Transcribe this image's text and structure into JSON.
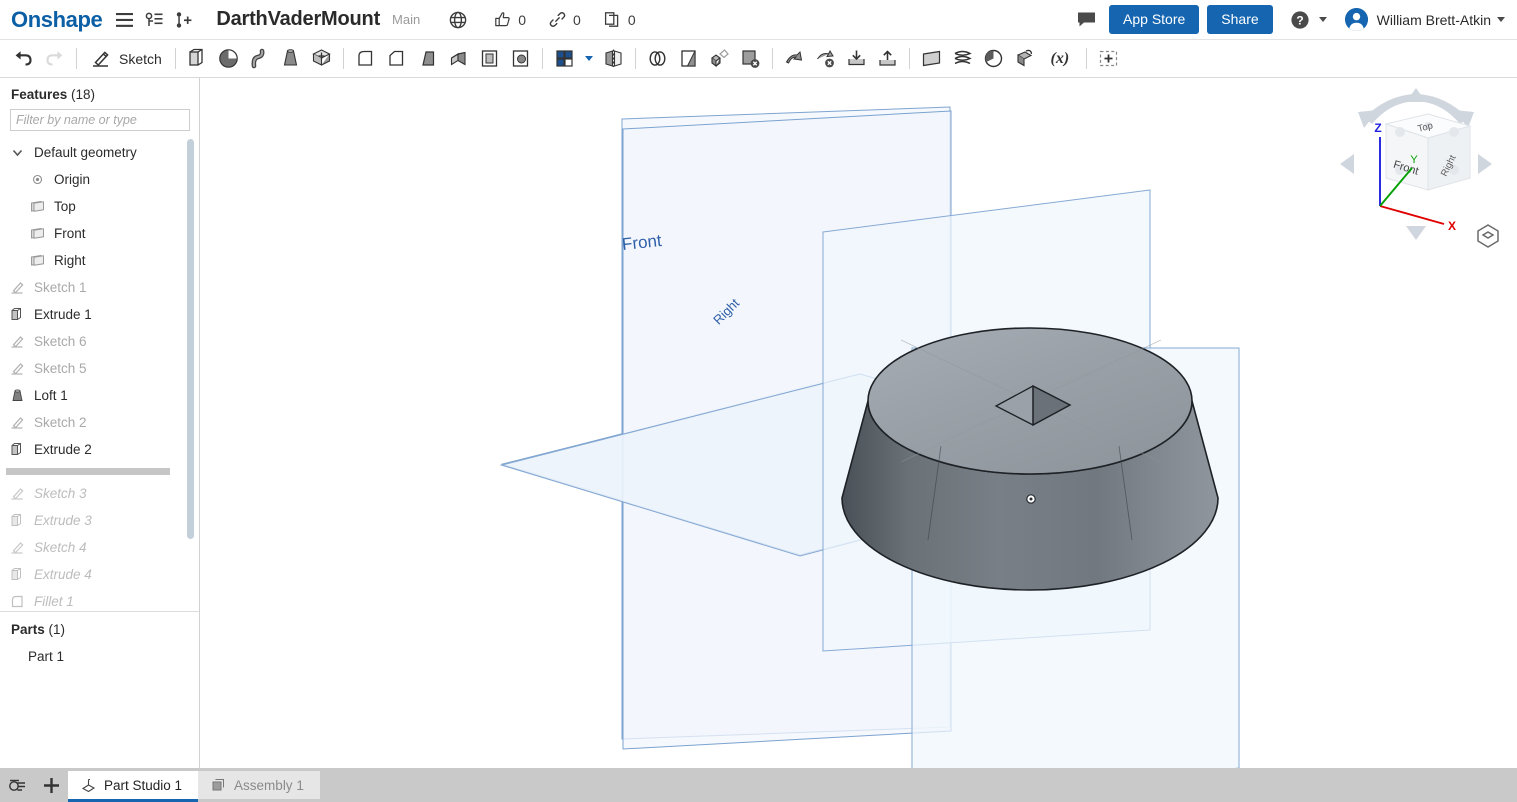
{
  "header": {
    "brand": "Onshape",
    "hamburger_icon": "hamburger-menu-icon",
    "versions_icon": "version-history-icon",
    "branch_icon": "branch-add-icon",
    "document_title": "DarthVaderMount",
    "workspace": "Main",
    "globe_icon": "globe-icon",
    "counters": [
      {
        "icon": "thumbs-up-icon",
        "value": "0"
      },
      {
        "icon": "link-icon",
        "value": "0"
      },
      {
        "icon": "copy-icon",
        "value": "0"
      }
    ],
    "comment_icon": "comment-bubble-icon",
    "app_store_label": "App Store",
    "share_label": "Share",
    "help_icon": "help-circle-icon",
    "user_name": "William Brett-Atkin",
    "accent_color": "#1565b0"
  },
  "toolbar": {
    "undo_icon": "undo-arrow-icon",
    "redo_icon": "redo-arrow-icon",
    "sketch_label": "Sketch",
    "sketch_icon": "sketch-pencil-icon",
    "tools": [
      {
        "icon": "extrude-icon"
      },
      {
        "icon": "revolve-icon"
      },
      {
        "icon": "sweep-icon"
      },
      {
        "icon": "loft-icon"
      },
      {
        "icon": "thicken-icon"
      },
      {
        "icon": "fillet-icon"
      },
      {
        "icon": "chamfer-icon"
      },
      {
        "icon": "draft-icon"
      },
      {
        "icon": "rib-icon"
      },
      {
        "icon": "shell-icon"
      },
      {
        "icon": "hole-icon"
      },
      {
        "icon": "pattern-icon"
      },
      {
        "icon": "mirror-icon"
      },
      {
        "icon": "boolean-icon"
      },
      {
        "icon": "split-icon"
      },
      {
        "icon": "transform-icon"
      },
      {
        "icon": "delete-face-icon"
      },
      {
        "icon": "move-face-icon"
      },
      {
        "icon": "replace-face-icon"
      },
      {
        "icon": "import-derived-icon"
      },
      {
        "icon": "export-icon"
      },
      {
        "icon": "plane-icon"
      },
      {
        "icon": "helix-icon"
      },
      {
        "icon": "curve-icon"
      },
      {
        "icon": "sketch-transform-icon"
      },
      {
        "icon": "variable-icon"
      },
      {
        "icon": "add-custom-feature-icon"
      }
    ],
    "variable_label": "(x)"
  },
  "sidebar": {
    "features_title": "Features",
    "features_count": "(18)",
    "filter_placeholder": "Filter by name or type",
    "default_geometry_label": "Default geometry",
    "default_geometry_children": [
      {
        "label": "Origin",
        "icon": "origin-icon"
      },
      {
        "label": "Top",
        "icon": "plane-icon"
      },
      {
        "label": "Front",
        "icon": "plane-icon"
      },
      {
        "label": "Right",
        "icon": "plane-icon"
      }
    ],
    "features": [
      {
        "label": "Sketch 1",
        "icon": "sketch-icon",
        "state": "dim"
      },
      {
        "label": "Extrude 1",
        "icon": "extrude-icon",
        "state": "normal"
      },
      {
        "label": "Sketch 6",
        "icon": "sketch-icon",
        "state": "dim"
      },
      {
        "label": "Sketch 5",
        "icon": "sketch-icon",
        "state": "dim"
      },
      {
        "label": "Loft 1",
        "icon": "loft-icon",
        "state": "normal"
      },
      {
        "label": "Sketch 2",
        "icon": "sketch-icon",
        "state": "dim"
      },
      {
        "label": "Extrude 2",
        "icon": "extrude-icon",
        "state": "normal"
      }
    ],
    "rollback_label": "rollback-bar",
    "rolled_back_features": [
      {
        "label": "Sketch 3",
        "icon": "sketch-icon",
        "state": "rolled"
      },
      {
        "label": "Extrude 3",
        "icon": "extrude-icon",
        "state": "rolled"
      },
      {
        "label": "Sketch 4",
        "icon": "sketch-icon",
        "state": "rolled"
      },
      {
        "label": "Extrude 4",
        "icon": "extrude-icon",
        "state": "rolled"
      },
      {
        "label": "Fillet 1",
        "icon": "fillet-icon",
        "state": "rolled"
      }
    ],
    "parts_title": "Parts",
    "parts_count": "(1)",
    "parts": [
      {
        "label": "Part 1"
      }
    ]
  },
  "viewport": {
    "plane_labels": {
      "front": "Front",
      "right": "Right"
    },
    "plane_color": "#4a7fc1",
    "model_name": "truncated-cone-mount",
    "viewcube": {
      "top_label": "Top",
      "front_label": "Front",
      "right_label": "Right",
      "axis_x": "X",
      "axis_y": "Y",
      "axis_z": "Z",
      "axis_x_color": "#e00000",
      "axis_y_color": "#00a000",
      "axis_z_color": "#2020e0"
    },
    "view_toggle_icon": "display-style-icon"
  },
  "bottom": {
    "filter_icon": "tab-filter-icon",
    "add_icon": "add-tab-icon",
    "tabs": [
      {
        "label": "Part Studio 1",
        "icon": "part-studio-icon",
        "active": true
      },
      {
        "label": "Assembly 1",
        "icon": "assembly-icon",
        "active": false
      }
    ]
  }
}
